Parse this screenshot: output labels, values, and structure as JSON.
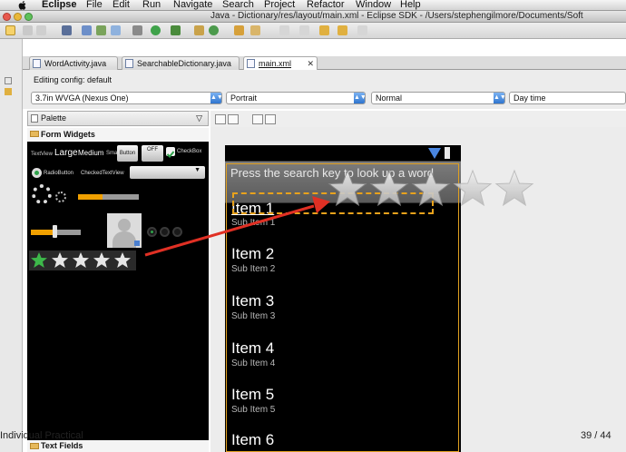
{
  "menubar": {
    "app": "Eclipse",
    "items": [
      "File",
      "Edit",
      "Run",
      "Navigate",
      "Search",
      "Project",
      "Refactor",
      "Window",
      "Help"
    ]
  },
  "window": {
    "title": "Java - Dictionary/res/layout/main.xml - Eclipse SDK - /Users/stephengilmore/Documents/Soft"
  },
  "tabs": [
    {
      "label": "WordActivity.java",
      "active": false
    },
    {
      "label": "SearchableDictionary.java",
      "active": false
    },
    {
      "label": "main.xml",
      "active": true,
      "close": "✕"
    }
  ],
  "config": {
    "label": "Editing config:  default",
    "device": "3.7in WVGA (Nexus One)",
    "orientation": "Portrait",
    "mode": "Normal",
    "time": "Day time"
  },
  "palette": {
    "title": "Palette",
    "group": "Form Widgets",
    "group2": "Text Fields",
    "widgets": {
      "textview": "TextView",
      "large": "Large",
      "medium": "Medium",
      "small": "Small",
      "button": "Button",
      "toggle": "OFF",
      "checkbox": "CheckBox",
      "radio": "RadioButton",
      "checked": "CheckedTextView"
    }
  },
  "preview": {
    "search_hint": "Press the search key to look up a word",
    "items": [
      {
        "title": "Item 1",
        "sub": "Sub Item 1"
      },
      {
        "title": "Item 2",
        "sub": "Sub Item 2"
      },
      {
        "title": "Item 3",
        "sub": "Sub Item 3"
      },
      {
        "title": "Item 4",
        "sub": "Sub Item 4"
      },
      {
        "title": "Item 5",
        "sub": "Sub Item 5"
      },
      {
        "title": "Item 6",
        "sub": ""
      }
    ],
    "rating_palette_green_stars": 1,
    "rating_palette_stars": 5,
    "rating_drag_stars": 5
  },
  "footer": {
    "left": "Individual Practical",
    "right": "39 / 44"
  },
  "colors": {
    "selection_orange": "#e8a21c",
    "arrow_red": "#e03024",
    "progress_orange": "#f0a000"
  }
}
